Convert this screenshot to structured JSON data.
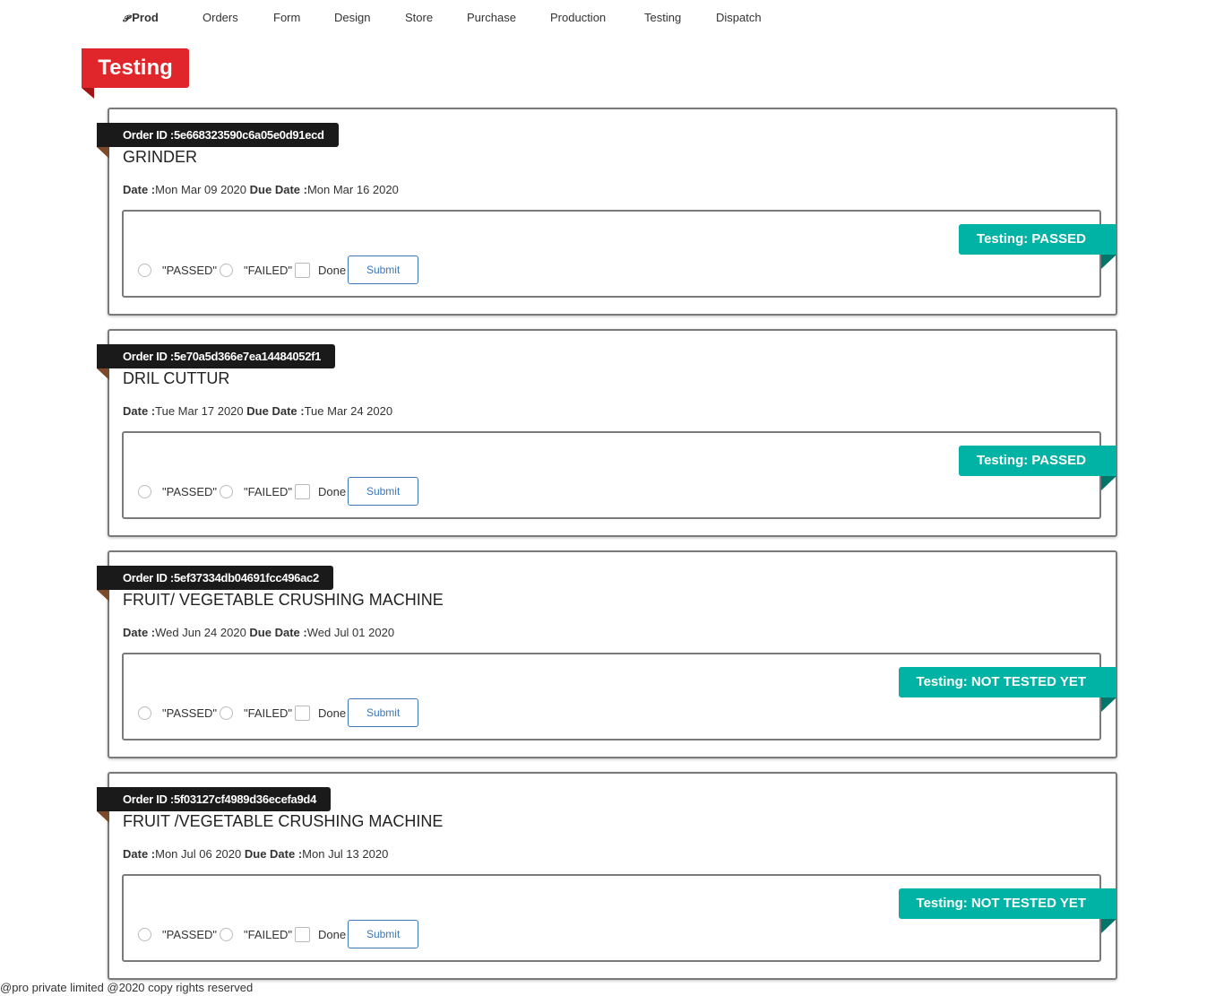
{
  "nav": {
    "brand": "Prod",
    "brand_icon": "pro-logo-icon",
    "items": [
      "Orders",
      "Form",
      "Design",
      "Store",
      "Purchase",
      "Production",
      "Testing",
      "Dispatch"
    ]
  },
  "page": {
    "title": "Testing"
  },
  "labels": {
    "date": "Date :",
    "due_date": "Due Date :",
    "passed": "\"PASSED\"",
    "failed": "\"FAILED\"",
    "done": "Done",
    "submit": "Submit"
  },
  "orders": [
    {
      "order_id": "Order ID :5e668323590c6a05e0d91ecd",
      "name": "GRINDER",
      "date": "Mon Mar 09 2020",
      "due_date": "Mon Mar 16 2020",
      "status": "Testing: PASSED"
    },
    {
      "order_id": "Order ID :5e70a5d366e7ea14484052f1",
      "name": "DRIL CUTTUR",
      "date": "Tue Mar 17 2020",
      "due_date": "Tue Mar 24 2020",
      "status": "Testing: PASSED"
    },
    {
      "order_id": "Order ID :5ef37334db04691fcc496ac2",
      "name": "FRUIT/ VEGETABLE CRUSHING MACHINE",
      "date": "Wed Jun 24 2020",
      "due_date": "Wed Jul 01 2020",
      "status": "Testing: NOT TESTED YET"
    },
    {
      "order_id": "Order ID :5f03127cf4989d36ecefa9d4",
      "name": "FRUIT /VEGETABLE CRUSHING MACHINE",
      "date": "Mon Jul 06 2020",
      "due_date": "Mon Jul 13 2020",
      "status": "Testing: NOT TESTED YET"
    }
  ],
  "colors": {
    "page_ribbon": "#e0262a",
    "order_tag": "#1a1a1a",
    "status_ribbon": "#00b3a4",
    "submit": "#3a78b8"
  },
  "footer": {
    "text": "@pro private limited @2020 copy rights reserved"
  }
}
